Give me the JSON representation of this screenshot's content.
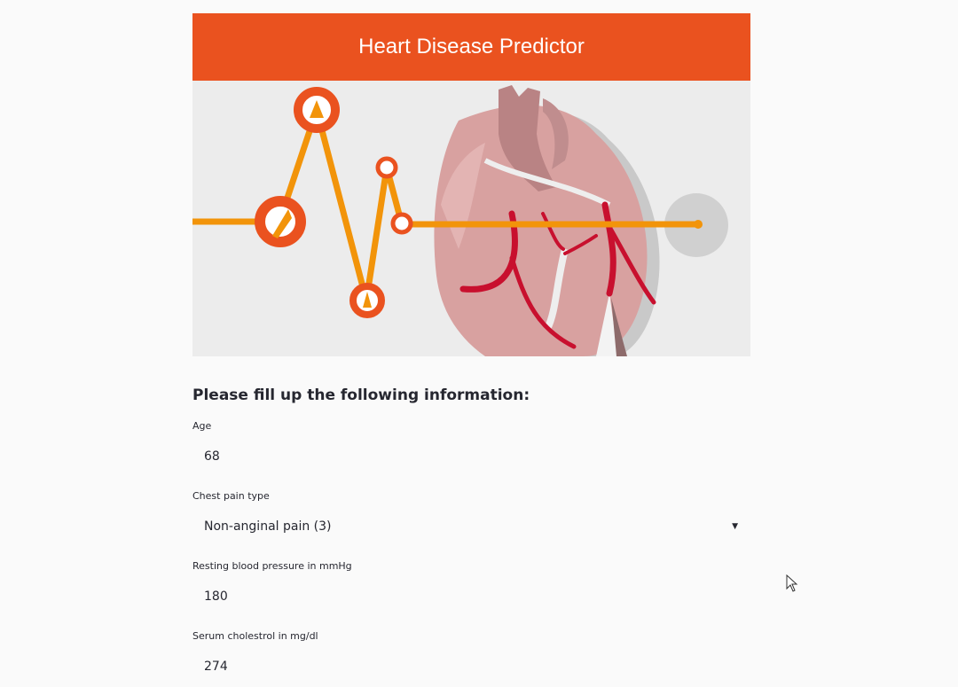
{
  "header": {
    "title": "Heart Disease Predictor"
  },
  "hero": {
    "image_alt": "heart-ecg-illustration"
  },
  "form": {
    "heading": "Please fill up the following information:",
    "fields": [
      {
        "label": "Age",
        "value": "68",
        "type": "number"
      },
      {
        "label": "Chest pain type",
        "value": "Non-anginal pain (3)",
        "type": "select"
      },
      {
        "label": "Resting blood pressure in mmHg",
        "value": "180",
        "type": "number"
      },
      {
        "label": "Serum cholestrol in mg/dl",
        "value": "274",
        "type": "number"
      }
    ]
  },
  "colors": {
    "accent": "#ea521f",
    "page_bg": "#fafafa",
    "ecg_line": "#f2940a",
    "heart": "#d8a1a0",
    "artery": "#c8102e"
  },
  "icons": {
    "select_caret": "caret-down-icon",
    "pointer": "mouse-cursor-icon"
  }
}
